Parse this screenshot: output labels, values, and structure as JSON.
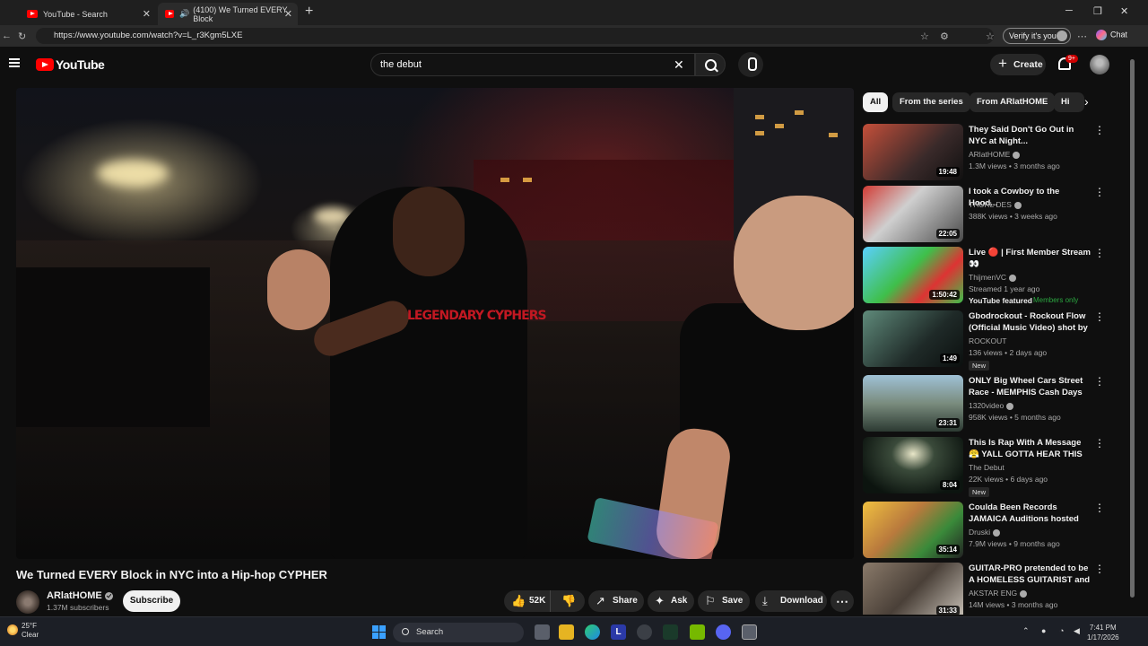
{
  "browser": {
    "tabs": [
      {
        "title": "YouTube - Search"
      },
      {
        "title": "(4100) We Turned EVERY Block"
      }
    ],
    "url": "https://www.youtube.com/watch?v=L_r3Kgm5LXE",
    "verify_label": "Verify it's you",
    "chat_label": "Chat"
  },
  "header": {
    "logo_text": "YouTube",
    "search_value": "the debut",
    "create_label": "Create",
    "notifications_badge": "9+"
  },
  "video": {
    "shirt_text": "LEGENDARY CYPHERS",
    "title": "We Turned EVERY Block in NYC into a Hip-hop CYPHER",
    "channel": "ARlatHOME",
    "subscribers": "1.37M subscribers",
    "subscribe_label": "Subscribe",
    "likes": "52K",
    "share_label": "Share",
    "ask_label": "Ask",
    "save_label": "Save",
    "download_label": "Download"
  },
  "chips": [
    "All",
    "From the series",
    "From ARlatHOME",
    "Hi"
  ],
  "recommendations": [
    {
      "title": "They Said Don't Go Out in NYC at Night...",
      "channel": "ARlatHOME",
      "meta": "1.3M views • 3 months ago",
      "duration": "19:48",
      "thumb": "#7a4b3a"
    },
    {
      "title": "I took a Cowboy to the Hood...",
      "channel": "THURL DES",
      "meta": "388K views • 3 weeks ago",
      "duration": "22:05",
      "thumb": "#a83c36"
    },
    {
      "title": "Live 🔴 | First Member Stream 👀",
      "channel": "ThijmenVC",
      "meta": "Streamed 1 year ago",
      "badge": "YouTube featured",
      "members": "Members only",
      "duration": "1:50:42",
      "thumb": "#3fbf4a"
    },
    {
      "title": "Gbodrockout - Rockout Flow (Official Music Video) shot by ...",
      "channel": "ROCKOUT",
      "meta": "136 views • 2 days ago",
      "badge": "New",
      "duration": "1:49",
      "thumb": "#2d3a36"
    },
    {
      "title": "ONLY Big Wheel Cars Street Race - MEMPHIS Cash Days",
      "channel": "1320video",
      "meta": "958K views • 5 months ago",
      "duration": "23:31",
      "thumb": "#6f8e9e"
    },
    {
      "title": "This Is Rap With A Message 😤 YALL GOTTA HEAR THIS ONE ...",
      "channel": "The Debut",
      "meta": "22K views • 6 days ago",
      "badge": "New",
      "duration": "8:04",
      "thumb": "#1b2a20"
    },
    {
      "title": "Coulda Been Records JAMAICA Auditions hosted by Druski & ...",
      "channel": "Druski",
      "meta": "7.9M views • 9 months ago",
      "duration": "35:14",
      "thumb": "#b97a3d"
    },
    {
      "title": "GUITAR-PRO pretended to be A HOMELESS GUITARIST and ...",
      "channel": "AKSTAR ENG",
      "meta": "14M views • 3 months ago",
      "duration": "31:33",
      "thumb": "#5a5148"
    }
  ],
  "taskbar": {
    "temperature": "25°F",
    "condition": "Clear",
    "search_label": "Search",
    "time": "7:41 PM",
    "date": "1/17/2026"
  }
}
